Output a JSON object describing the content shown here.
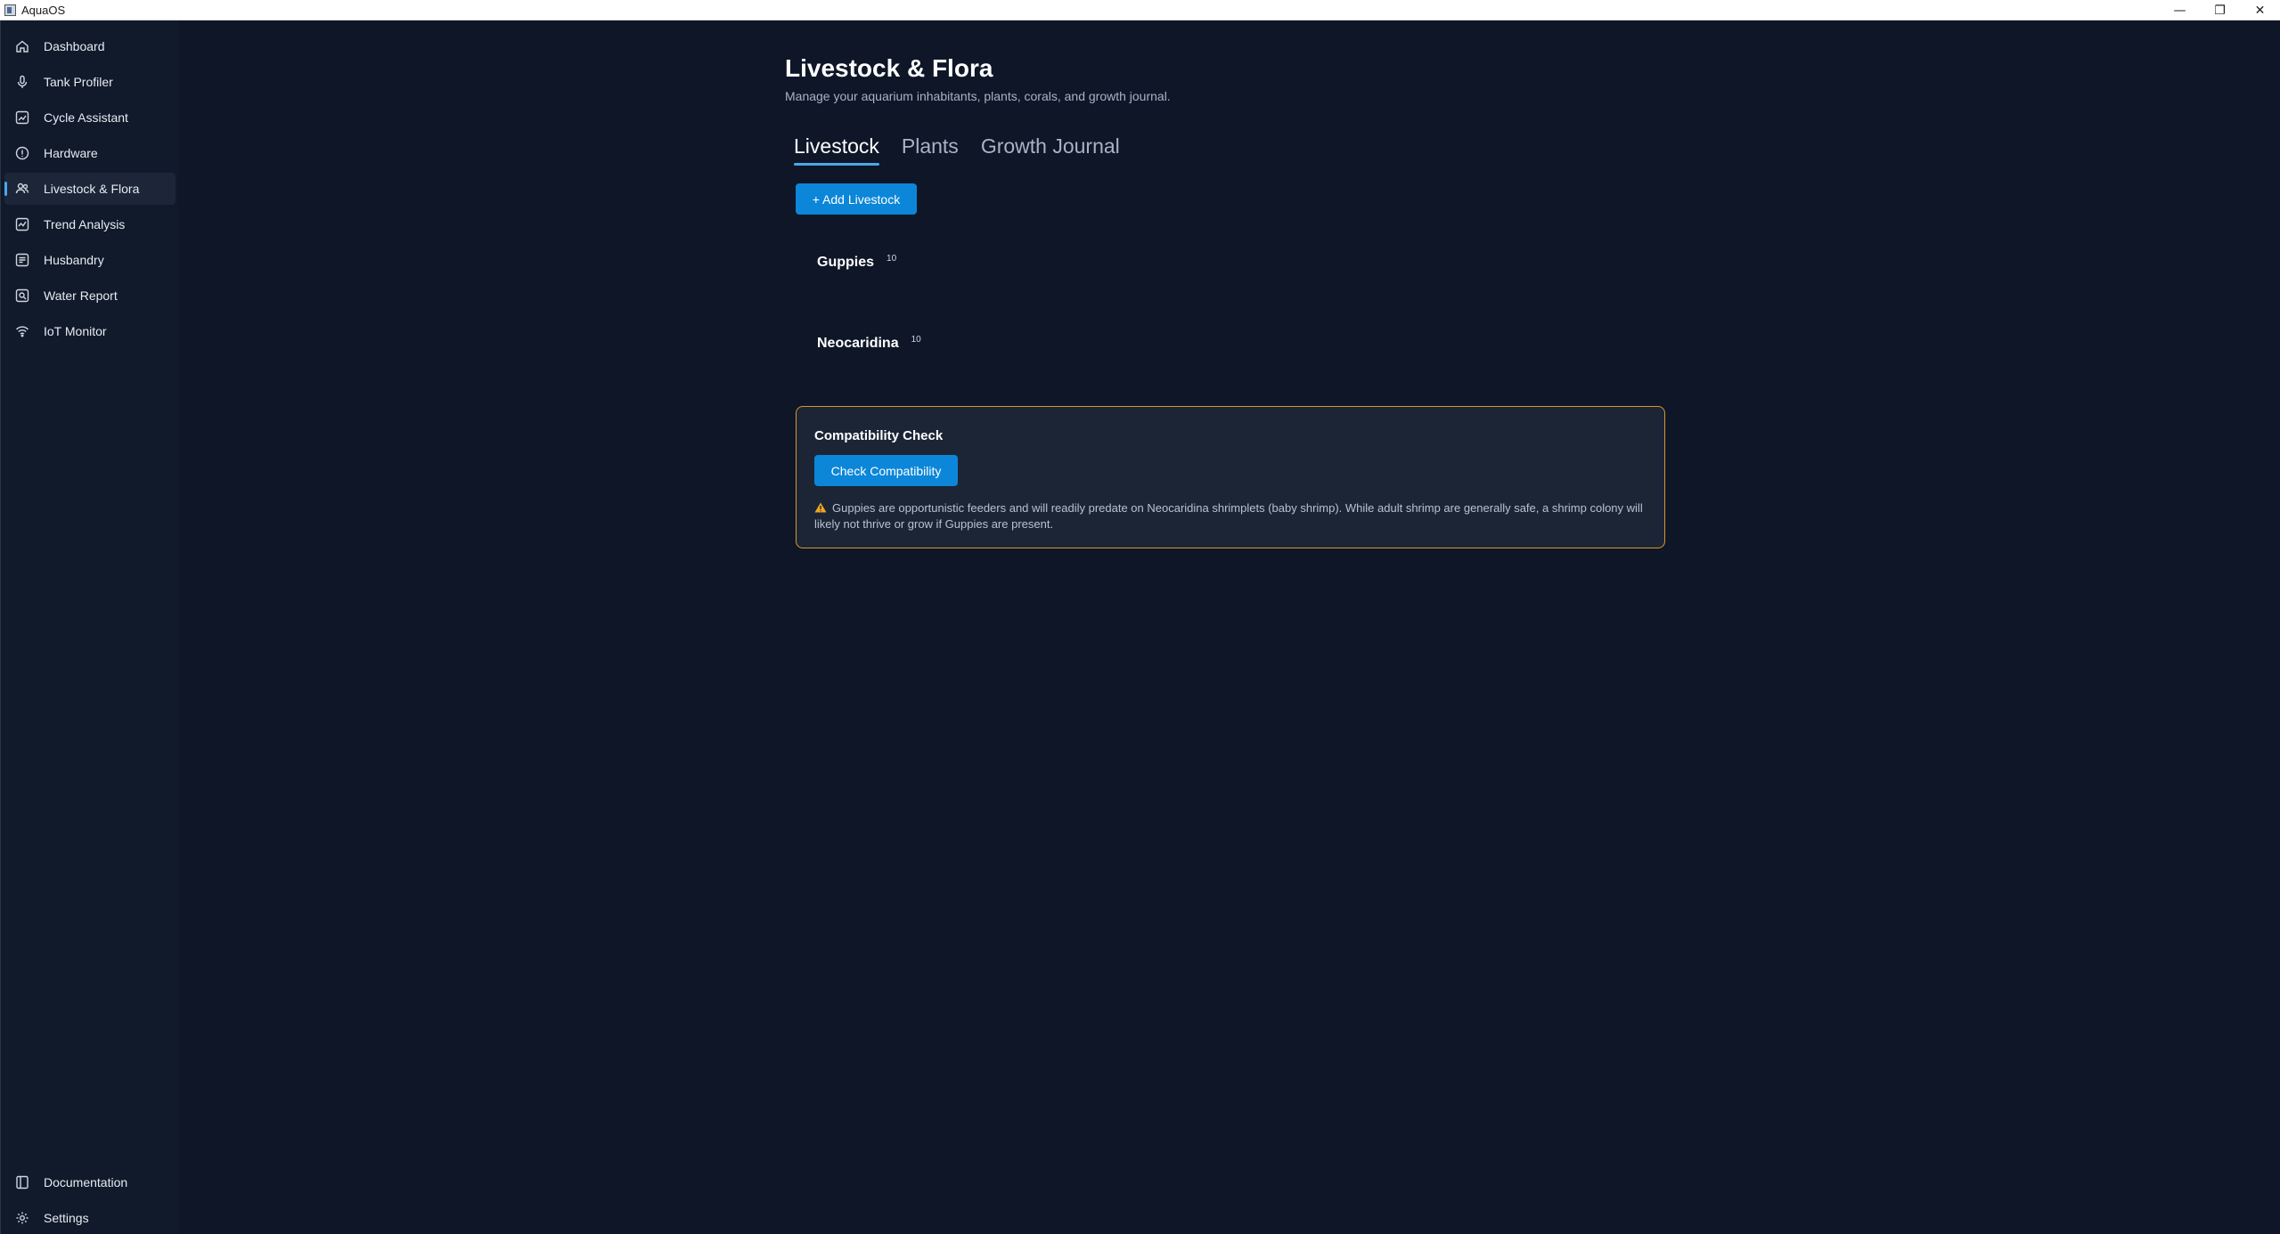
{
  "window": {
    "title": "AquaOS",
    "minimize": "—",
    "restore": "❐",
    "close": "✕"
  },
  "sidebar": {
    "items": [
      {
        "label": "Dashboard",
        "icon": "home-icon"
      },
      {
        "label": "Tank Profiler",
        "icon": "mic-icon"
      },
      {
        "label": "Cycle Assistant",
        "icon": "chart-box-icon"
      },
      {
        "label": "Hardware",
        "icon": "info-circle-icon"
      },
      {
        "label": "Livestock & Flora",
        "icon": "people-icon",
        "active": true
      },
      {
        "label": "Trend Analysis",
        "icon": "trend-icon"
      },
      {
        "label": "Husbandry",
        "icon": "list-box-icon"
      },
      {
        "label": "Water Report",
        "icon": "search-box-icon"
      },
      {
        "label": "IoT Monitor",
        "icon": "wifi-icon"
      }
    ],
    "bottom_items": [
      {
        "label": "Documentation",
        "icon": "book-icon"
      },
      {
        "label": "Settings",
        "icon": "gear-icon"
      }
    ]
  },
  "page": {
    "title": "Livestock & Flora",
    "subtitle": "Manage your aquarium inhabitants, plants, corals, and growth journal."
  },
  "tabs": [
    {
      "label": "Livestock",
      "active": true
    },
    {
      "label": "Plants"
    },
    {
      "label": "Growth Journal"
    }
  ],
  "add_button_label": "+ Add Livestock",
  "livestock": [
    {
      "name": "Guppies",
      "count": "10"
    },
    {
      "name": "Neocaridina",
      "count": "10"
    }
  ],
  "compatibility": {
    "title": "Compatibility Check",
    "button_label": "Check Compatibility",
    "message": "Guppies are opportunistic feeders and will readily predate on Neocaridina shrimplets (baby shrimp). While adult shrimp are generally safe, a shrimp colony will likely not thrive or grow if Guppies are present.",
    "border_color": "#d9962a"
  },
  "colors": {
    "background": "#0e1628",
    "sidebar": "#111a2b",
    "accent": "#0c86d8"
  }
}
